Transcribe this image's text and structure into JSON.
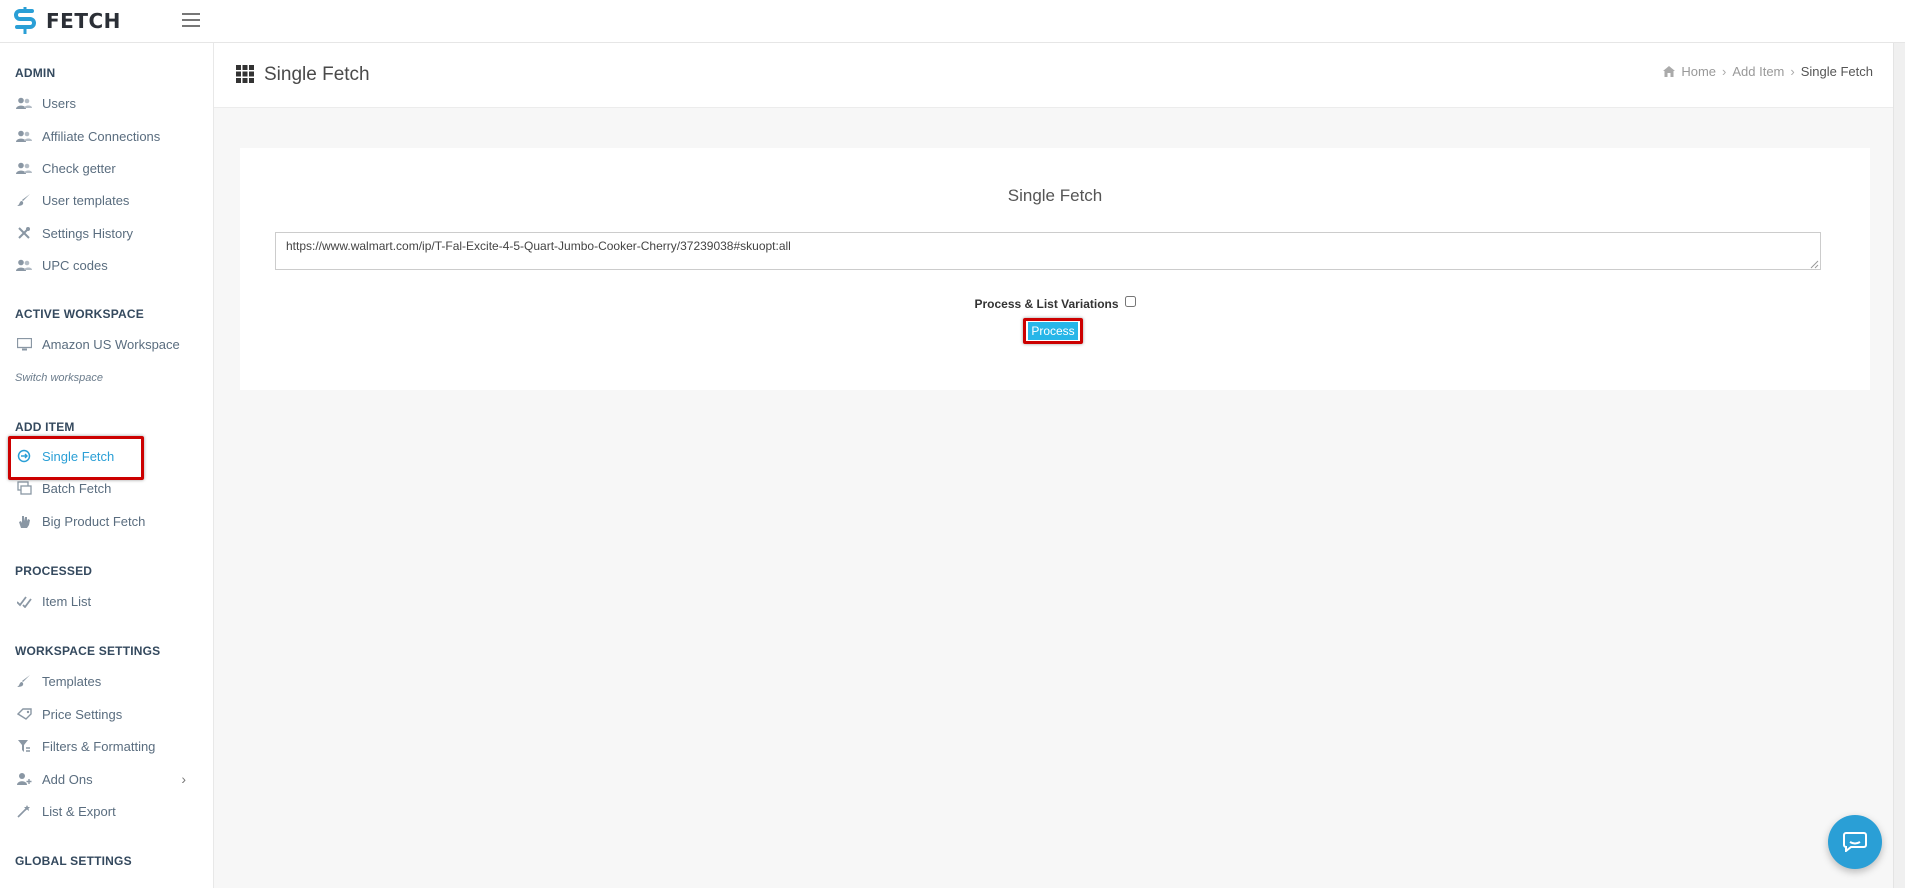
{
  "app": {
    "name": "FETCH"
  },
  "sidebar": {
    "sections": {
      "admin": "ADMIN",
      "active_workspace": "ACTIVE WORKSPACE",
      "add_item": "ADD ITEM",
      "processed": "PROCESSED",
      "workspace_settings": "WORKSPACE SETTINGS",
      "global_settings": "GLOBAL SETTINGS"
    },
    "admin_items": [
      {
        "label": "Users",
        "icon": "users-icon"
      },
      {
        "label": "Affiliate Connections",
        "icon": "users-icon"
      },
      {
        "label": "Check getter",
        "icon": "users-icon"
      },
      {
        "label": "User templates",
        "icon": "brush-icon"
      },
      {
        "label": "Settings History",
        "icon": "tools-icon"
      },
      {
        "label": "UPC codes",
        "icon": "users-icon"
      }
    ],
    "workspace": {
      "label": "Amazon US Workspace",
      "icon": "monitor-icon",
      "switch_label": "Switch workspace"
    },
    "add_item_items": [
      {
        "label": "Single Fetch",
        "icon": "fetch-icon",
        "active": true
      },
      {
        "label": "Batch Fetch",
        "icon": "batch-icon"
      },
      {
        "label": "Big Product Fetch",
        "icon": "hand-icon"
      }
    ],
    "processed_items": [
      {
        "label": "Item List",
        "icon": "checks-icon"
      }
    ],
    "workspace_settings_items": [
      {
        "label": "Templates",
        "icon": "brush-icon"
      },
      {
        "label": "Price Settings",
        "icon": "tags-icon"
      },
      {
        "label": "Filters & Formatting",
        "icon": "filter-icon"
      },
      {
        "label": "Add Ons",
        "icon": "user-plus-icon"
      },
      {
        "label": "List & Export",
        "icon": "magic-icon"
      }
    ]
  },
  "header": {
    "title": "Single Fetch",
    "breadcrumb": {
      "home": "Home",
      "parent": "Add Item",
      "current": "Single Fetch"
    }
  },
  "main": {
    "card_title": "Single Fetch",
    "url_value": "https://www.walmart.com/ip/T-Fal-Excite-4-5-Quart-Jumbo-Cooker-Cherry/37239038#skuopt:all",
    "variations_label": "Process & List Variations",
    "variations_checked": false,
    "process_label": "Process"
  },
  "colors": {
    "accent": "#2a9fd6",
    "button": "#27b6e8",
    "highlight": "#cc0000"
  }
}
